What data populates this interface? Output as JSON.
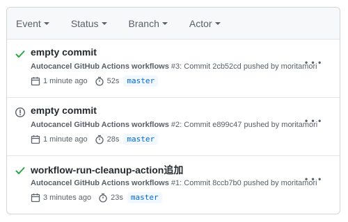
{
  "filters": [
    {
      "label": "Event"
    },
    {
      "label": "Status"
    },
    {
      "label": "Branch"
    },
    {
      "label": "Actor"
    }
  ],
  "runs": [
    {
      "status": "success",
      "title": "empty commit",
      "workflow": "Autocancel GitHub Actions workflows",
      "detail": "#3: Commit 2cb52cd pushed by moritamori",
      "time": "1 minute ago",
      "duration": "52s",
      "branch": "master"
    },
    {
      "status": "cancelled",
      "title": "empty commit",
      "workflow": "Autocancel GitHub Actions workflows",
      "detail": "#2: Commit e899c47 pushed by moritamori",
      "time": "1 minute ago",
      "duration": "28s",
      "branch": "master"
    },
    {
      "status": "success",
      "title": "workflow-run-cleanup-action追加",
      "workflow": "Autocancel GitHub Actions workflows",
      "detail": "#1: Commit 8ccb7b0 pushed by moritamori",
      "time": "3 minutes ago",
      "duration": "23s",
      "branch": "master"
    }
  ],
  "more_label": "• • •",
  "colors": {
    "success": "#28a745",
    "neutral": "#586069",
    "branch": "#0366d6"
  }
}
